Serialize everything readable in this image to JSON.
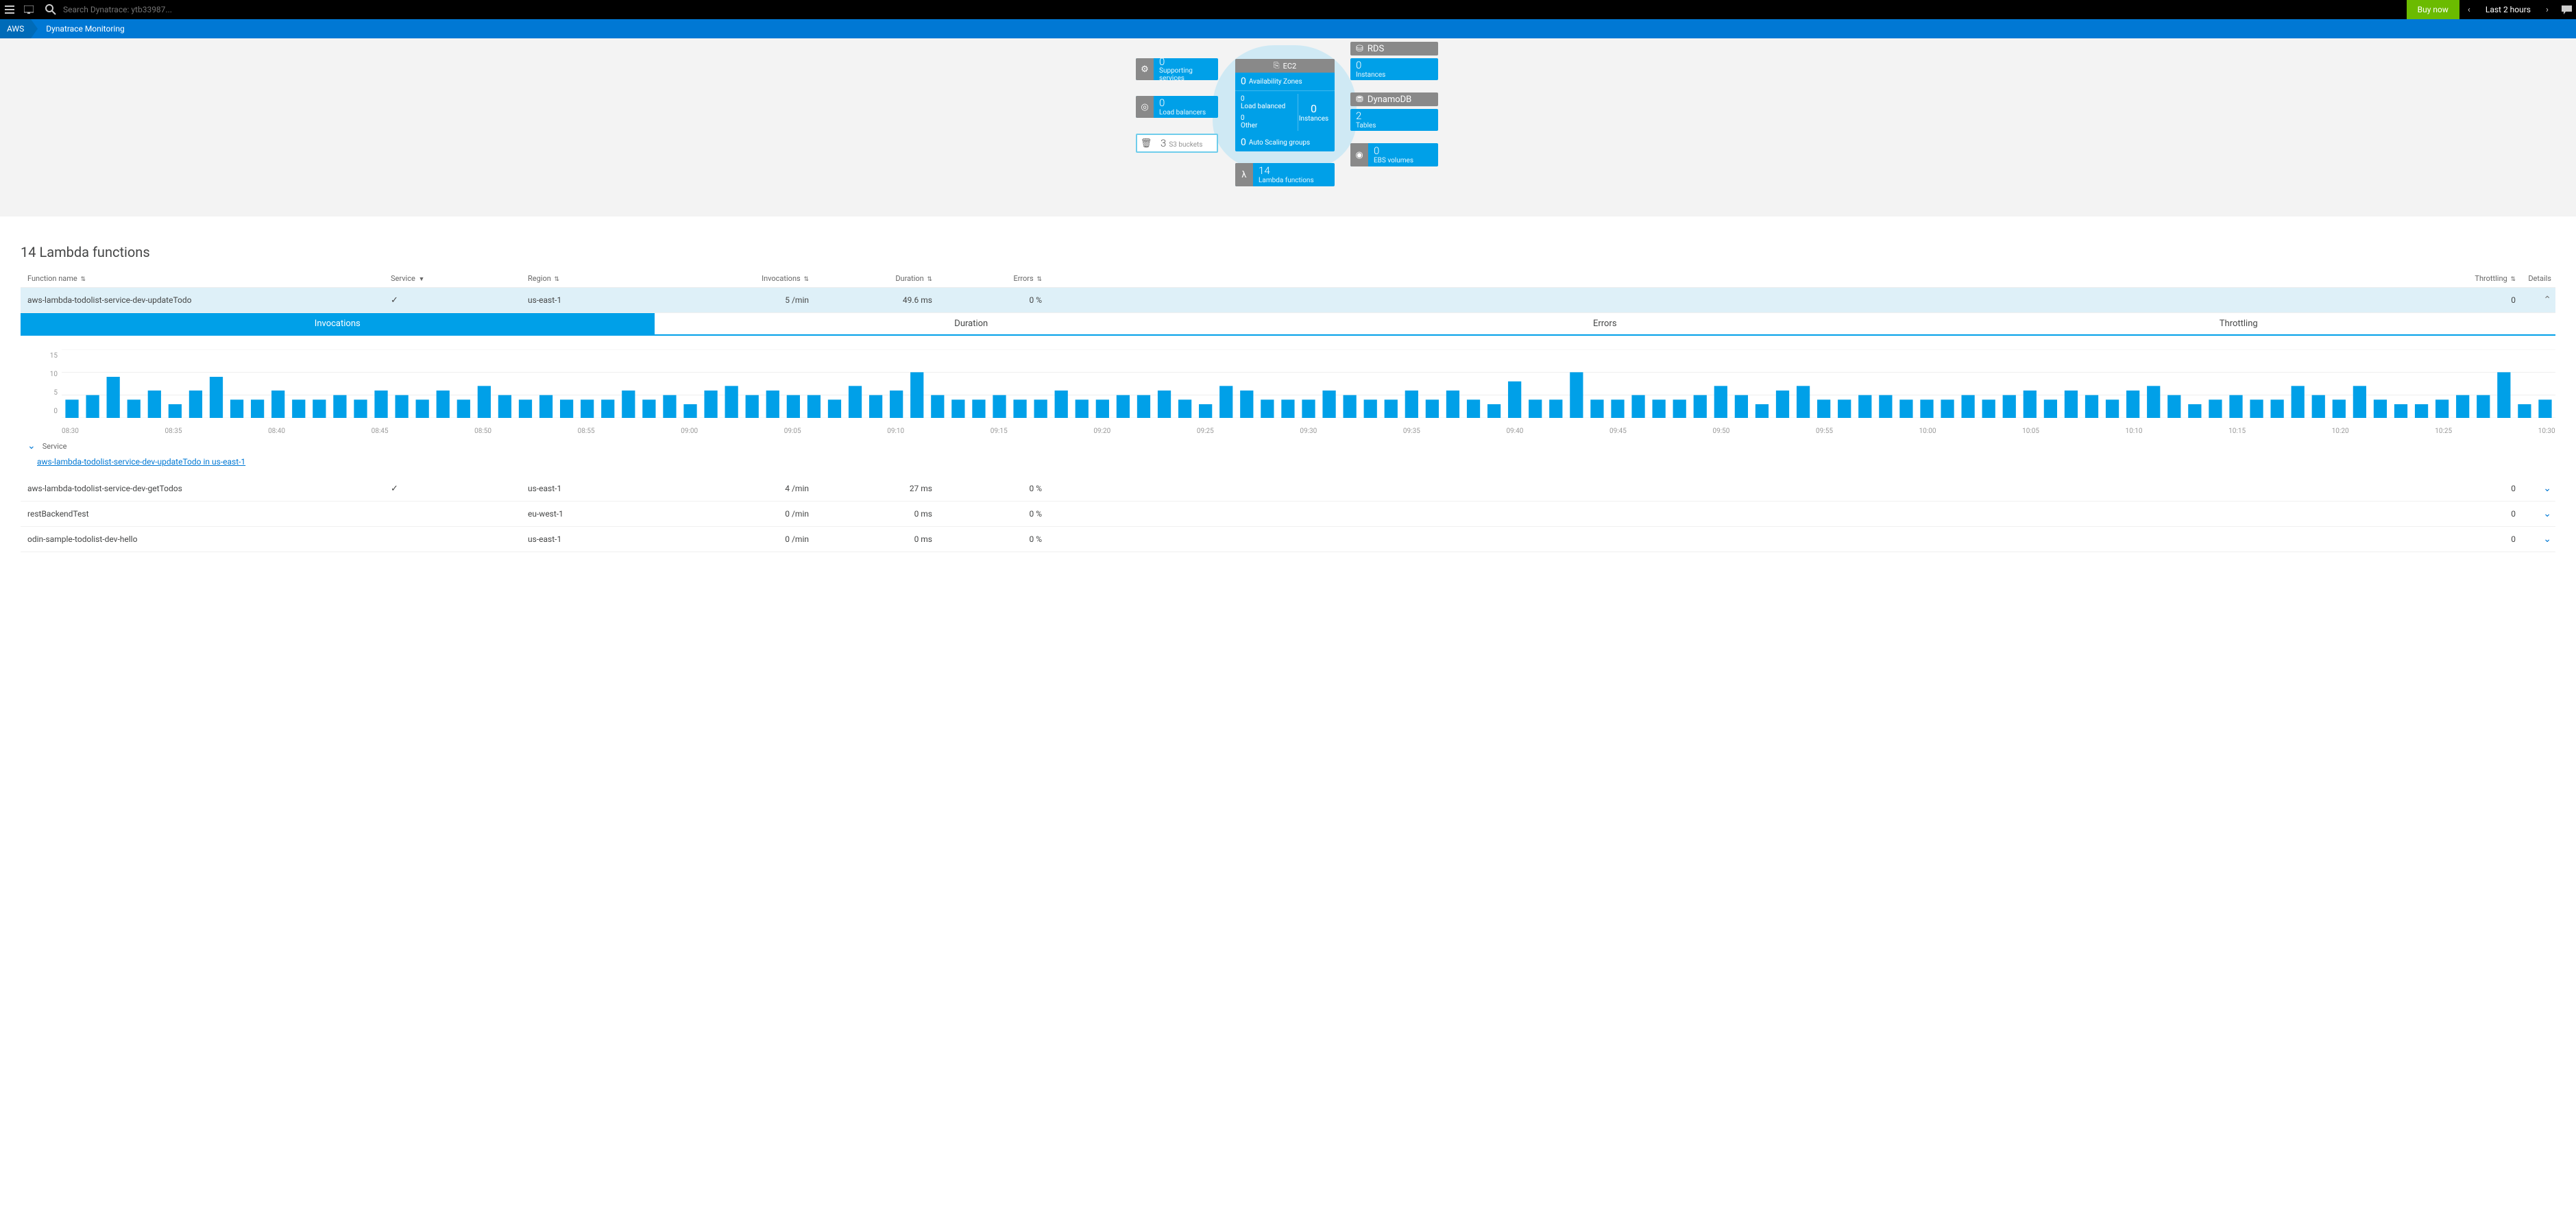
{
  "topbar": {
    "search_placeholder": "Search Dynatrace: ytb33987...",
    "buy_now": "Buy now",
    "time_label": "Last 2 hours"
  },
  "breadcrumb": {
    "root": "AWS",
    "current": "Dynatrace Monitoring"
  },
  "overview": {
    "supporting_services": {
      "count": "0",
      "label": "Supporting services"
    },
    "load_balancers": {
      "count": "0",
      "label": "Load balancers"
    },
    "s3": {
      "count": "3",
      "label": "S3 buckets"
    },
    "ec2_header": "EC2",
    "availability_zones": {
      "count": "0",
      "label": "Availability Zones"
    },
    "load_balanced": {
      "count": "0",
      "label": "Load balanced"
    },
    "other": {
      "count": "0",
      "label": "Other"
    },
    "instances": {
      "count": "0",
      "label": "Instances"
    },
    "auto_scaling": {
      "count": "0",
      "label": "Auto Scaling groups"
    },
    "lambda": {
      "count": "14",
      "label": "Lambda functions"
    },
    "rds": {
      "header": "RDS",
      "count": "0",
      "label": "Instances"
    },
    "dynamo": {
      "header": "DynamoDB",
      "count": "2",
      "label": "Tables"
    },
    "ebs": {
      "count": "0",
      "label": "EBS volumes"
    }
  },
  "section": {
    "title": "14 Lambda functions"
  },
  "columns": {
    "name": "Function name",
    "service": "Service",
    "region": "Region",
    "invocations": "Invocations",
    "duration": "Duration",
    "errors": "Errors",
    "throttling": "Throttling",
    "details": "Details"
  },
  "tabs": {
    "invocations": "Invocations",
    "duration": "Duration",
    "errors": "Errors",
    "throttling": "Throttling"
  },
  "rows": [
    {
      "name": "aws-lambda-todolist-service-dev-updateTodo",
      "service": true,
      "region": "us-east-1",
      "inv": "5 /min",
      "dur": "49.6 ms",
      "err": "0 %",
      "thr": "0",
      "expanded": true
    },
    {
      "name": "aws-lambda-todolist-service-dev-getTodos",
      "service": true,
      "region": "us-east-1",
      "inv": "4 /min",
      "dur": "27 ms",
      "err": "0 %",
      "thr": "0",
      "expanded": false
    },
    {
      "name": "restBackendTest",
      "service": false,
      "region": "eu-west-1",
      "inv": "0 /min",
      "dur": "0 ms",
      "err": "0 %",
      "thr": "0",
      "expanded": false
    },
    {
      "name": "odin-sample-todolist-dev-hello",
      "service": false,
      "region": "us-east-1",
      "inv": "0 /min",
      "dur": "0 ms",
      "err": "0 %",
      "thr": "0",
      "expanded": false
    }
  ],
  "service_sub_label": "Service",
  "service_link": "aws-lambda-todolist-service-dev-updateTodo in us-east-1",
  "chart_data": {
    "type": "bar",
    "ylabel": "",
    "ylim": [
      0,
      15
    ],
    "yticks": [
      0,
      5,
      10,
      15
    ],
    "xticks": [
      "08:30",
      "08:35",
      "08:40",
      "08:45",
      "08:50",
      "08:55",
      "09:00",
      "09:05",
      "09:10",
      "09:15",
      "09:20",
      "09:25",
      "09:30",
      "09:35",
      "09:40",
      "09:45",
      "09:50",
      "09:55",
      "10:00",
      "10:05",
      "10:10",
      "10:15",
      "10:20",
      "10:25",
      "10:30"
    ],
    "values": [
      4,
      5,
      9,
      4,
      6,
      3,
      6,
      9,
      4,
      4,
      6,
      4,
      4,
      5,
      4,
      6,
      5,
      4,
      6,
      4,
      7,
      5,
      4,
      5,
      4,
      4,
      4,
      6,
      4,
      5,
      3,
      6,
      7,
      5,
      6,
      5,
      5,
      4,
      7,
      5,
      6,
      10,
      5,
      4,
      4,
      5,
      4,
      4,
      6,
      4,
      4,
      5,
      5,
      6,
      4,
      3,
      7,
      6,
      4,
      4,
      4,
      6,
      5,
      4,
      4,
      6,
      4,
      6,
      4,
      3,
      8,
      4,
      4,
      10,
      4,
      4,
      5,
      4,
      4,
      5,
      7,
      5,
      3,
      6,
      7,
      4,
      4,
      5,
      5,
      4,
      4,
      4,
      5,
      4,
      5,
      6,
      4,
      6,
      5,
      4,
      6,
      7,
      5,
      3,
      4,
      5,
      4,
      4,
      7,
      5,
      4,
      7,
      4,
      3,
      3,
      4,
      5,
      5,
      10,
      3,
      4
    ]
  }
}
